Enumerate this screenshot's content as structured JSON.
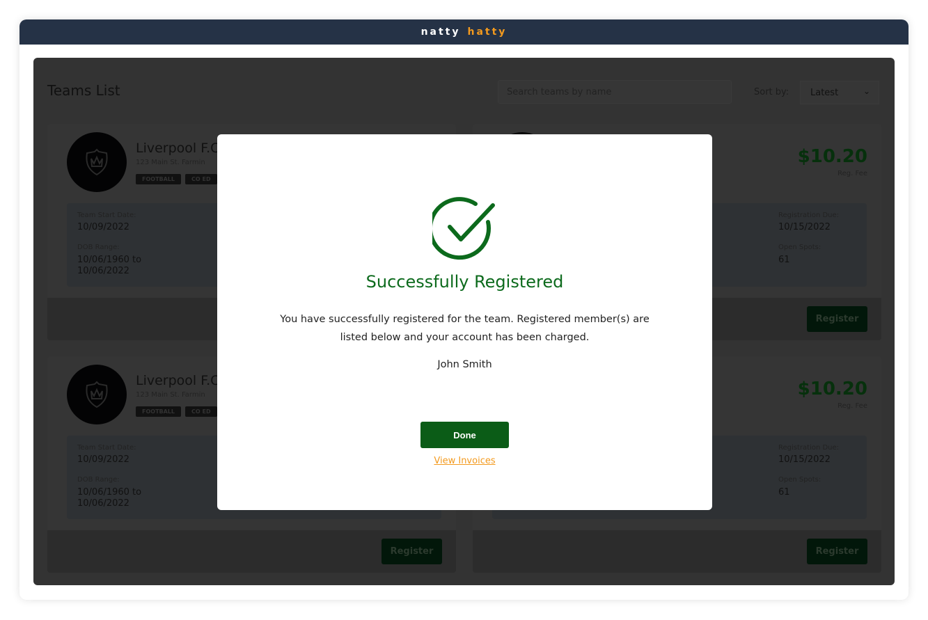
{
  "brand": {
    "part1": "natty",
    "part2": "hatty",
    "accent": "#f39a1e",
    "bar_color": "#253246"
  },
  "page": {
    "title": "Teams List",
    "search_placeholder": "Search teams by name",
    "sort_label": "Sort by:",
    "sort_value": "Latest"
  },
  "cards": [
    {
      "name": "Liverpool F.C",
      "address": "123 Main St. Farmin",
      "tags": [
        "FOOTBALL",
        "CO ED"
      ],
      "start_label": "Team Start Date:",
      "start": "10/09/2022",
      "dob_label": "DOB Range:",
      "dob1": "10/06/1960 to",
      "dob2": "10/06/2022",
      "register": "Register"
    },
    {
      "fee": "$10.20",
      "fee_label": "Reg. Fee",
      "due_label": "Registration Due:",
      "due": "10/15/2022",
      "spots_label": "Open Spots:",
      "spots": "61",
      "register": "Register"
    },
    {
      "name": "Liverpool F.C",
      "address": "123 Main St. Farmin",
      "tags": [
        "FOOTBALL",
        "CO ED"
      ],
      "start_label": "Team Start Date:",
      "start": "10/09/2022",
      "dob_label": "DOB Range:",
      "dob1": "10/06/1960 to",
      "dob2": "10/06/2022",
      "register": "Register"
    },
    {
      "fee": "$10.20",
      "fee_label": "Reg. Fee",
      "due_label": "Registration Due:",
      "due": "10/15/2022",
      "spots_label": "Open Spots:",
      "spots": "61",
      "register": "Register"
    }
  ],
  "modal": {
    "icon": "check-circle-icon",
    "title": "Successfully Registered",
    "body": "You have successfully registered for the team. Registered member(s) are listed below and your account has been charged.",
    "member": "John Smith",
    "done": "Done",
    "invoices": "View Invoices",
    "success_color": "#0c6a1c"
  }
}
